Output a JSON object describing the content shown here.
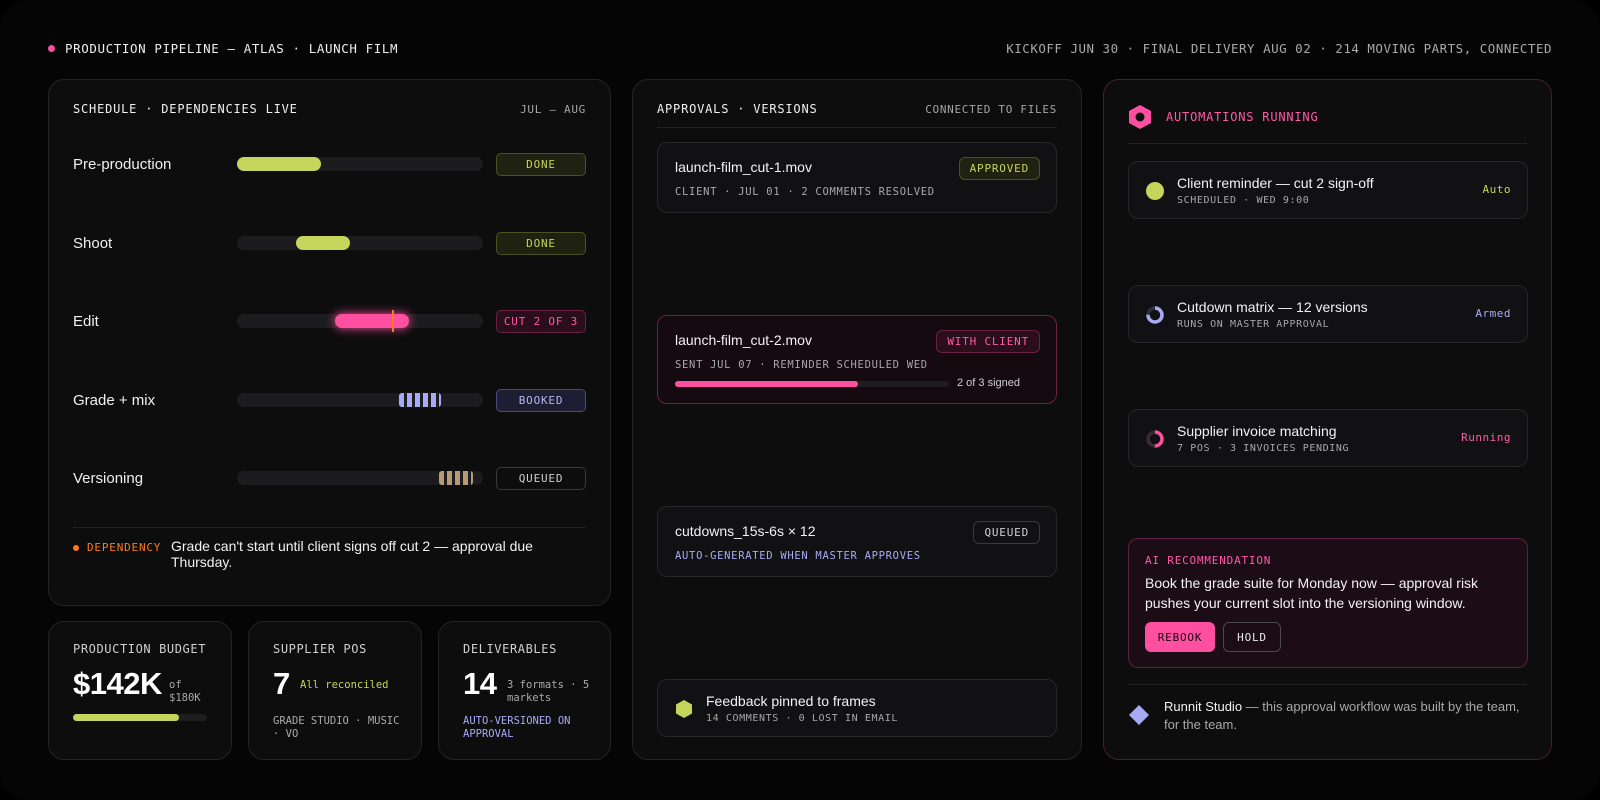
{
  "header": {
    "title": "PRODUCTION PIPELINE — ATLAS · LAUNCH FILM",
    "meta": "KICKOFF JUN 30 · FINAL DELIVERY AUG 02 · 214 MOVING PARTS, CONNECTED",
    "accent_color": "#ff4fa0"
  },
  "schedule": {
    "title": "SCHEDULE · DEPENDENCIES LIVE",
    "range": "JUL — AUG",
    "phases": [
      {
        "label": "Pre-production",
        "status": "DONE",
        "start": 0.0,
        "end": 0.34,
        "style": "solid",
        "color": "#c5d45a"
      },
      {
        "label": "Shoot",
        "status": "DONE",
        "start": 0.24,
        "end": 0.46,
        "style": "solid",
        "color": "#c5d45a"
      },
      {
        "label": "Edit",
        "status": "CUT 2 OF 3",
        "start": 0.4,
        "end": 0.7,
        "style": "glow",
        "color": "#ff4fa0",
        "today": 0.63
      },
      {
        "label": "Grade + mix",
        "status": "BOOKED",
        "start": 0.66,
        "end": 0.83,
        "style": "striped",
        "color": "#a9aaf5"
      },
      {
        "label": "Versioning",
        "status": "QUEUED",
        "start": 0.82,
        "end": 0.96,
        "style": "striped",
        "color": "#b89a74"
      }
    ],
    "dependency": {
      "tag": "DEPENDENCY",
      "text": "Grade can't start until client signs off cut 2 — approval due Thursday.",
      "color": "#ff7a1a"
    }
  },
  "stats": {
    "budget": {
      "title": "PRODUCTION BUDGET",
      "value": "$142K",
      "of": "of $180K",
      "progress": 0.79
    },
    "supplier": {
      "title": "SUPPLIER POS",
      "value": "7",
      "note": "All reconciled",
      "sub": "GRADE STUDIO · MUSIC · VO"
    },
    "deliverables": {
      "title": "DELIVERABLES",
      "value": "14",
      "note": "3 formats · 5 markets",
      "sub": "AUTO-VERSIONED ON APPROVAL"
    }
  },
  "approvals": {
    "title": "APPROVALS · VERSIONS",
    "meta": "CONNECTED TO FILES",
    "files": [
      {
        "name": "launch-film_cut-1.mov",
        "badge": "APPROVED",
        "sub": "CLIENT · JUL 01 · 2 COMMENTS RESOLVED"
      },
      {
        "name": "launch-film_cut-2.mov",
        "badge": "WITH CLIENT",
        "sub": "SENT JUL 07 · REMINDER SCHEDULED WED",
        "progress": 0.667,
        "progress_text": "2 of 3 signed"
      },
      {
        "name": "cutdowns_15s-6s × 12",
        "badge": "QUEUED",
        "sub": "AUTO-GENERATED WHEN MASTER APPROVES"
      }
    ],
    "feedback": {
      "title": "Feedback pinned to frames",
      "sub": "14 COMMENTS · 0 LOST IN EMAIL"
    }
  },
  "automations": {
    "title": "AUTOMATIONS RUNNING",
    "items": [
      {
        "title": "Client reminder — cut 2 sign-off",
        "sub": "SCHEDULED · WED 9:00",
        "state": "Auto",
        "icon": "filled-circle-icon",
        "color": "#c5d45a"
      },
      {
        "title": "Cutdown matrix — 12 versions",
        "sub": "RUNS ON MASTER APPROVAL",
        "state": "Armed",
        "icon": "partial-ring-icon",
        "color": "#a9aaf5"
      },
      {
        "title": "Supplier invoice matching",
        "sub": "7 POS · 3 INVOICES PENDING",
        "state": "Running",
        "icon": "spinner-ring-icon",
        "color": "#ff4fa0"
      }
    ],
    "recommendation": {
      "title": "AI RECOMMENDATION",
      "body": "Book the grade suite for Monday now — approval risk pushes your current slot into the versioning window.",
      "primary": "REBOOK",
      "secondary": "HOLD"
    },
    "footer": {
      "brand": "Runnit Studio",
      "text": " — this approval workflow was built by the team, for the team."
    }
  }
}
